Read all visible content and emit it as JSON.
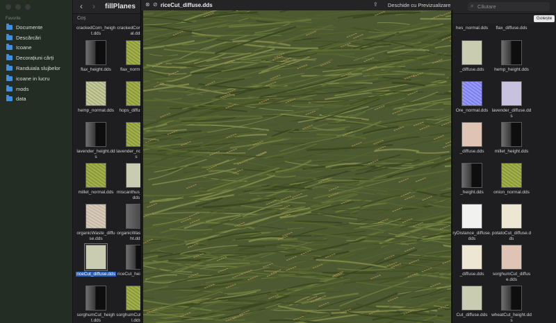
{
  "sidebar": {
    "section": "Favorite",
    "items": [
      {
        "label": "Documente",
        "icon": "folder-icon"
      },
      {
        "label": "Descărcări",
        "icon": "folder-icon"
      },
      {
        "label": "Icoane",
        "icon": "folder-icon"
      },
      {
        "label": "Decorațiuni cărți",
        "icon": "folder-icon"
      },
      {
        "label": "Randuiala slujbelor",
        "icon": "folder-icon"
      },
      {
        "label": "icoane in lucru",
        "icon": "folder-icon"
      },
      {
        "label": "mods",
        "icon": "folder-icon"
      },
      {
        "label": "data",
        "icon": "folder-icon"
      }
    ]
  },
  "toolbar": {
    "back": "‹",
    "forward": "›",
    "title": "fillPlanes",
    "search_placeholder": "Căutare"
  },
  "pathbar": {
    "label": "Coș",
    "clear_button": "Golește"
  },
  "grid": {
    "left_items": [
      {
        "label": "crackedCorn_height.dds",
        "thumb": "none"
      },
      {
        "label": "crackedCorn_normal.dds",
        "thumb": "none"
      },
      {
        "label": "flax_height.dds",
        "thumb": "height"
      },
      {
        "label": "flax_normal.dds",
        "thumb": "diffuse"
      },
      {
        "label": "hemp_normal.dds",
        "thumb": "normal-olive"
      },
      {
        "label": "hops_diffuse.dds",
        "thumb": "diffuse"
      },
      {
        "label": "lavender_height.dds",
        "thumb": "height"
      },
      {
        "label": "lavender_normal.dds",
        "thumb": "diffuse"
      },
      {
        "label": "millet_normal.dds",
        "thumb": "diffuse"
      },
      {
        "label": "miscanthus_height.dds",
        "thumb": "pale"
      },
      {
        "label": "organicWaste_diffuse.dds",
        "thumb": "organic"
      },
      {
        "label": "organicWaste_height.dds",
        "thumb": "gray"
      },
      {
        "label": "riceCut_diffuse.dds",
        "thumb": "pale"
      },
      {
        "label": "riceCut_height.dds",
        "thumb": "height"
      },
      {
        "label": "sorghumCut_height.dds",
        "thumb": "height"
      },
      {
        "label": "sorghumCut_normal.dds",
        "thumb": "diffuse"
      }
    ],
    "right_items": [
      {
        "label": "hes_normal.dds",
        "thumb": "none"
      },
      {
        "label": "flax_diffuse.dds",
        "thumb": "none"
      },
      {
        "label": "_diffuse.dds",
        "thumb": "pale"
      },
      {
        "label": "hemp_height.dds",
        "thumb": "height"
      },
      {
        "label": "Ore_normal.dds",
        "thumb": "blue"
      },
      {
        "label": "lavender_diffuse.dds",
        "thumb": "lavender"
      },
      {
        "label": "_diffuse.dds",
        "thumb": "peach"
      },
      {
        "label": "millet_height.dds",
        "thumb": "height"
      },
      {
        "label": "_height.dds",
        "thumb": "height"
      },
      {
        "label": "onion_normal.dds",
        "thumb": "diffuse"
      },
      {
        "label": "ryDistance_diffuse.dds",
        "thumb": "white"
      },
      {
        "label": "potatoCut_diffuse.dds",
        "thumb": "cream"
      },
      {
        "label": "_diffuse.dds",
        "thumb": "cream"
      },
      {
        "label": "sorghumCut_diffuse.dds",
        "thumb": "peach"
      },
      {
        "label": "Cut_diffuse.dds",
        "thumb": "pale"
      },
      {
        "label": "wheatCut_height.dds",
        "thumb": "height"
      }
    ],
    "selected": "riceCut_diffuse.dds"
  },
  "quicklook": {
    "title": "riceCut_diffuse.dds",
    "open_with": "Deschide cu Previzualizare"
  },
  "colors": {
    "accent": "#2a5fb5",
    "folder": "#3f8ee6",
    "grass_dark": "#3f4a26",
    "grass_light": "#7f8a4a",
    "seed": "#b89a5a"
  }
}
